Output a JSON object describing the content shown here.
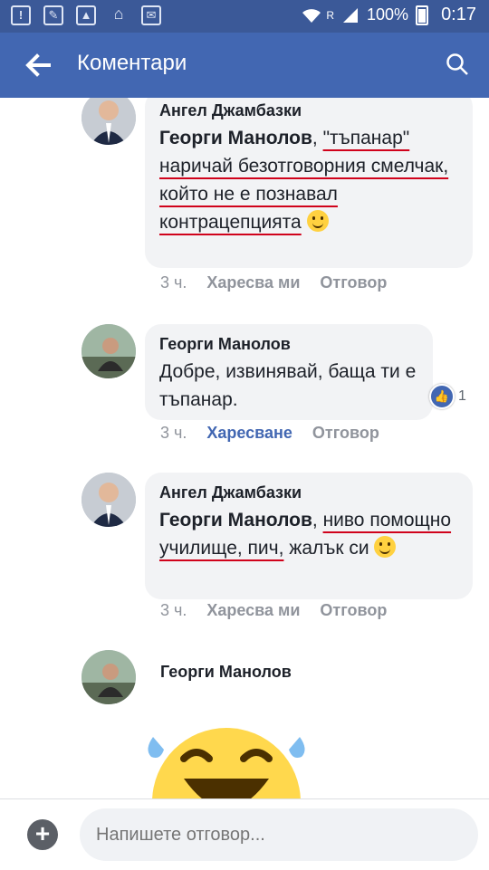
{
  "status_bar": {
    "network_label": "R",
    "battery_percent": "100%",
    "time": "0:17"
  },
  "app_bar": {
    "title": "Коментари",
    "back_icon": "arrow-left-icon",
    "search_icon": "search-icon"
  },
  "comments": [
    {
      "author": "Ангел Джамбазки",
      "mention": "Георги Манолов",
      "after_mention": ", ",
      "text_underlined": "\"тъпанар\" наричай безотговорния смелчак, който не е познавал контрацепцията",
      "emoji": "smiling-face",
      "time": "3 ч.",
      "like_label": "Харесва ми",
      "reply_label": "Отговор"
    },
    {
      "author": "Георги Манолов",
      "text": "Добре, извинявай, баща ти е тъпанар.",
      "reaction_count": "1",
      "time": "3 ч.",
      "like_label": "Харесване",
      "reply_label": "Отговор"
    },
    {
      "author": "Ангел Джамбазки",
      "mention": "Георги Манолов",
      "after_mention": ", ",
      "text_underlined": "ниво помощно училище, пич,",
      "text_tail": "жалък си",
      "emoji": "smiling-face",
      "time": "3 ч.",
      "like_label": "Харесва ми",
      "reply_label": "Отговор"
    },
    {
      "author": "Георги Манолов",
      "sticker": "laughing-tears-emoji"
    }
  ],
  "composer": {
    "placeholder": "Напишете отговор..."
  },
  "colors": {
    "status_bar": "#3b5998",
    "app_bar": "#4267b2",
    "bubble": "#f2f3f5",
    "underline": "#d0021b",
    "link_blue": "#4267b2"
  }
}
